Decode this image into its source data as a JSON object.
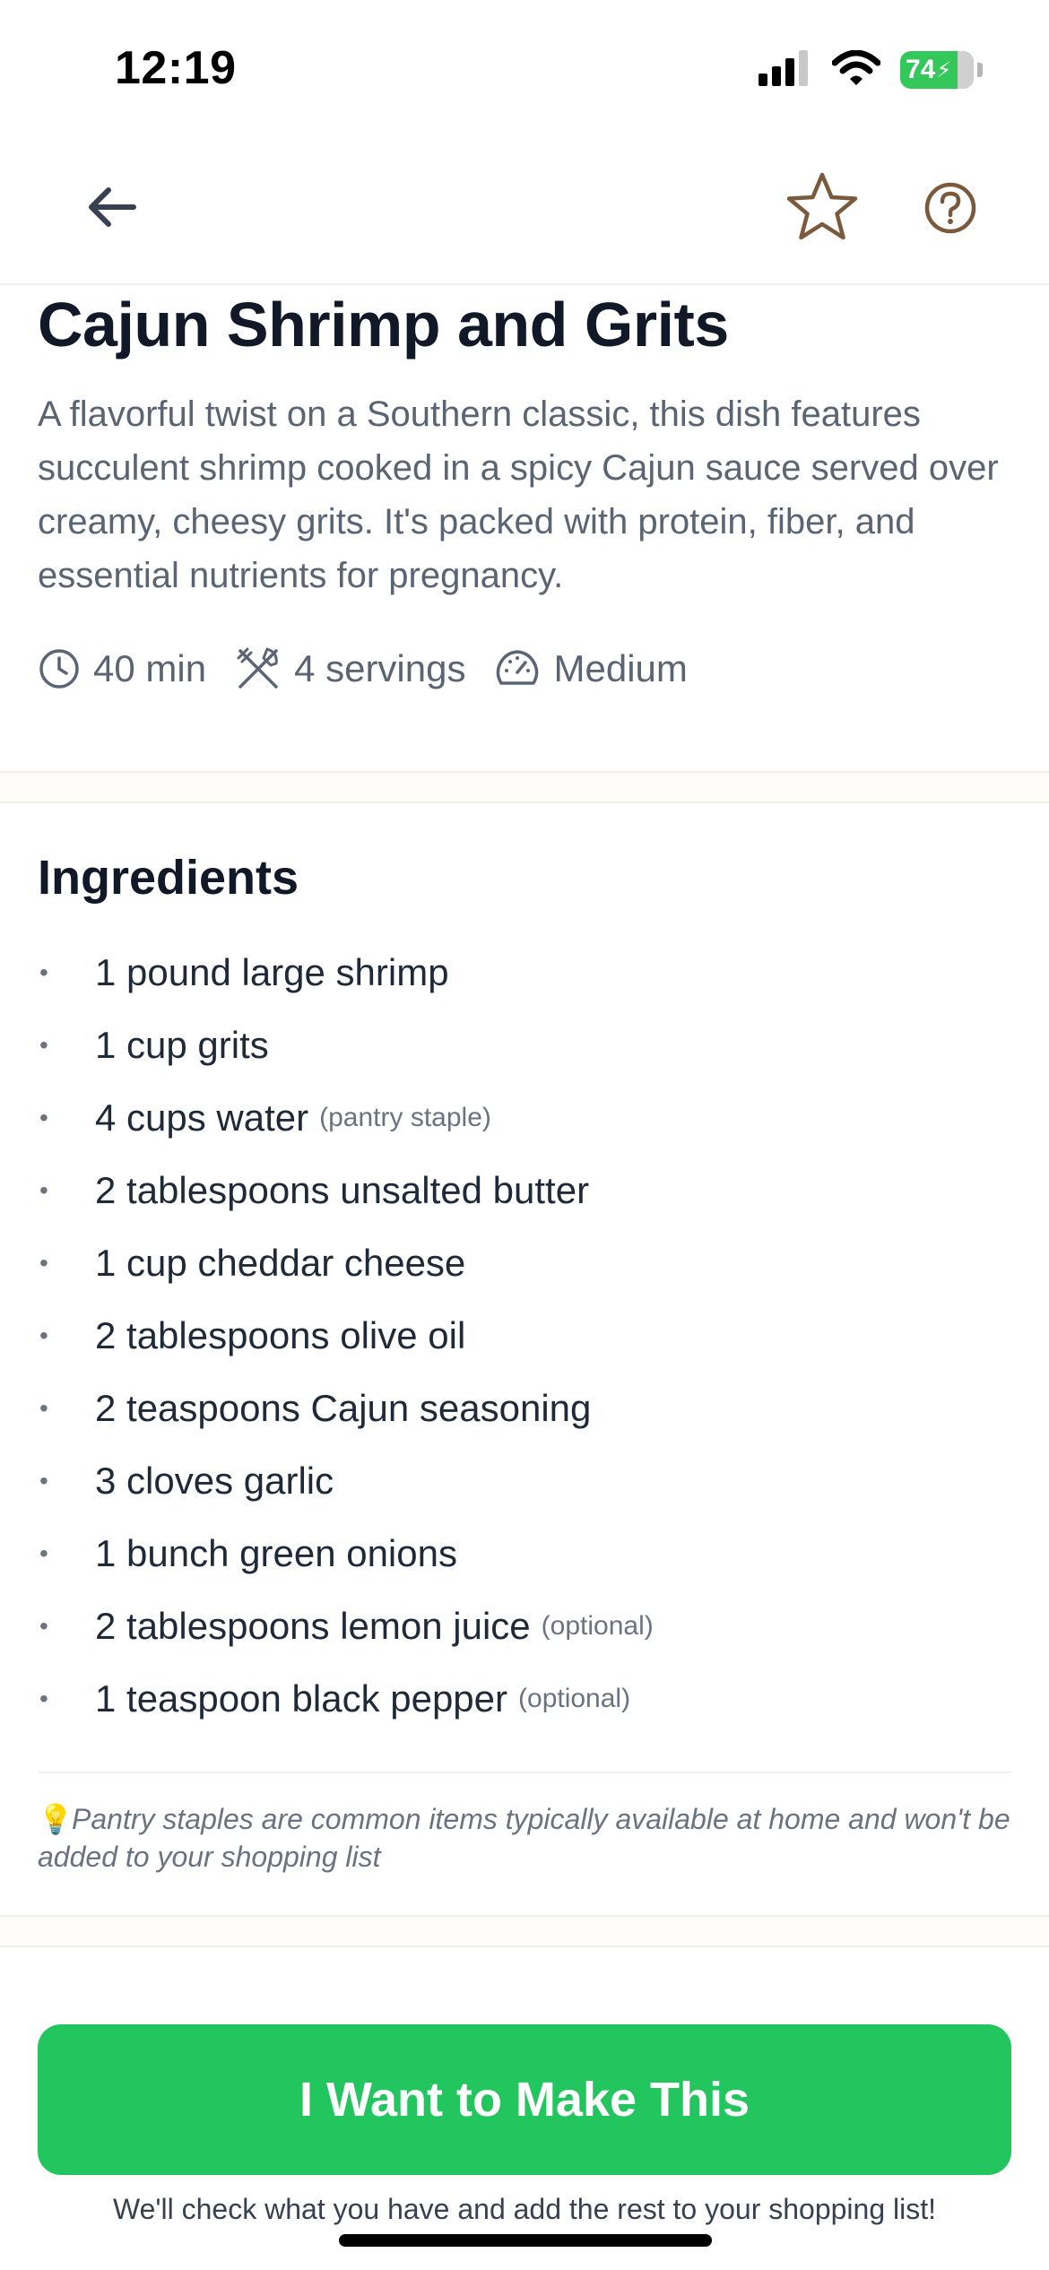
{
  "status_bar": {
    "time": "12:19",
    "battery": "74",
    "battery_color": "#34c759"
  },
  "nav": {
    "back_icon": "arrow-left-icon",
    "favorite_icon": "star-outline-icon",
    "help_icon": "question-circle-icon",
    "accent_color": "#7a5a3a"
  },
  "recipe": {
    "title": "Cajun Shrimp and Grits",
    "description": "A flavorful twist on a Southern classic, this dish features succulent shrimp cooked in a spicy Cajun sauce served over creamy, cheesy grits. It's packed with protein, fiber, and essential nutrients for pregnancy.",
    "time": "40 min",
    "servings": "4 servings",
    "difficulty": "Medium"
  },
  "ingredients": {
    "heading": "Ingredients",
    "bullet": "•",
    "items": [
      {
        "text": "1 pound large shrimp",
        "note": ""
      },
      {
        "text": "1 cup grits",
        "note": ""
      },
      {
        "text": "4 cups water",
        "note": "(pantry staple)"
      },
      {
        "text": "2 tablespoons unsalted butter",
        "note": ""
      },
      {
        "text": "1 cup cheddar cheese",
        "note": ""
      },
      {
        "text": "2 tablespoons olive oil",
        "note": ""
      },
      {
        "text": "2 teaspoons Cajun seasoning",
        "note": ""
      },
      {
        "text": "3 cloves garlic",
        "note": ""
      },
      {
        "text": "1 bunch green onions",
        "note": ""
      },
      {
        "text": "2 tablespoons lemon juice",
        "note": "(optional)"
      },
      {
        "text": "1 teaspoon black pepper",
        "note": "(optional)"
      }
    ],
    "pantry_note_icon": "💡",
    "pantry_note": "Pantry staples are common items typically available at home and won't be added to your shopping list"
  },
  "cta": {
    "label": "I Want to Make This",
    "subtext": "We'll check what you have and add the rest to your shopping list!",
    "color": "#22c55e"
  }
}
